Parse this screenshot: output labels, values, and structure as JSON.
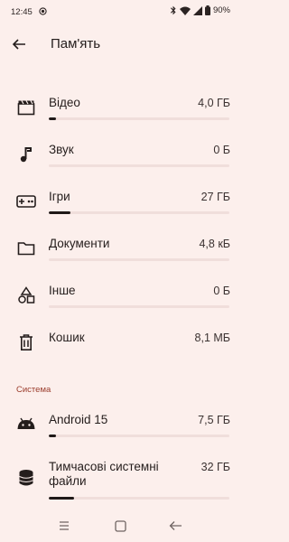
{
  "status_bar": {
    "time": "12:45",
    "battery": "90%"
  },
  "app_bar": {
    "title": "Пам'ять"
  },
  "items": [
    {
      "label": "",
      "size": "",
      "icon": "image-stack-icon",
      "fill": 0.02
    },
    {
      "label": "Відео",
      "size": "4,0 ГБ",
      "icon": "video-clapper-icon",
      "fill": 0.04
    },
    {
      "label": "Звук",
      "size": "0 Б",
      "icon": "music-note-icon",
      "fill": 0.0
    },
    {
      "label": "Ігри",
      "size": "27 ГБ",
      "icon": "gamepad-icon",
      "fill": 0.12
    },
    {
      "label": "Документи",
      "size": "4,8 кБ",
      "icon": "folder-icon",
      "fill": 0.0
    },
    {
      "label": "Інше",
      "size": "0 Б",
      "icon": "shapes-icon",
      "fill": 0.0
    },
    {
      "label": "Кошик",
      "size": "8,1 МБ",
      "icon": "trash-icon",
      "fill": 0.0
    }
  ],
  "system_section": {
    "header": "Система",
    "items": [
      {
        "label": "Android 15",
        "size": "7,5 ГБ",
        "icon": "android-icon",
        "fill": 0.04
      },
      {
        "label": "Тимчасові системні файли",
        "size": "32 ГБ",
        "icon": "database-icon",
        "fill": 0.14
      }
    ]
  },
  "colors": {
    "background": "#fcefec",
    "accent": "#9a3b2b",
    "bar_track": "#f0dedb",
    "bar_fill": "#1f1918"
  }
}
